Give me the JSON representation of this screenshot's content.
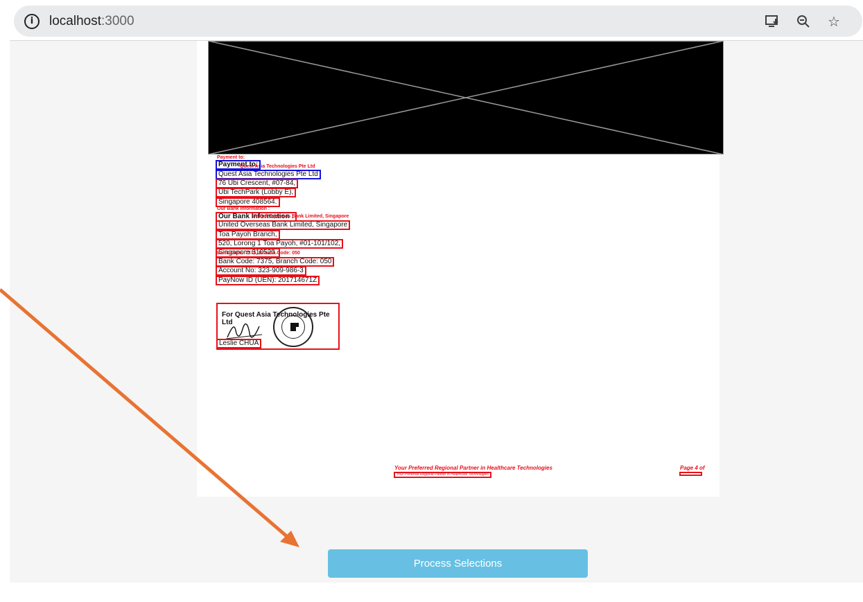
{
  "browser": {
    "url_host": "localhost",
    "url_port": ":3000",
    "icons": [
      "info-icon",
      "install-app-icon",
      "zoom-out-icon",
      "bookmark-star-icon"
    ]
  },
  "document": {
    "payment_to_small": "Payment to:",
    "payment_to_heading": "Payment to:",
    "company_small": "Quest Asia Technologies Pte Ltd",
    "company_name": "Quest Asia Technologies Pte Ltd",
    "address_1": "76 Ubi Crescent, #07-84,",
    "address_2": "Ubi TechPark (Lobby E),",
    "address_3": "Singapore 408564.",
    "bank_info_small": "Our Bank Information :",
    "bank_info_heading": "Our Bank Information :",
    "bank_small": "United Overseas Bank Limited, Singapore",
    "bank_name": "United Overseas Bank Limited, Singapore",
    "branch_1": "Toa Payoh Branch,",
    "branch_address": "520, Lorong 1 Toa Payoh, #01-101/102,",
    "branch_city": "Singapore 310520.",
    "bank_code_small": "Bank Code: 7375, Branch Code: 050",
    "bank_code": "Bank Code: 7375, Branch Code: 050",
    "account_no": "Account No: 323-909-986-3",
    "paynow": "PayNow ID (UEN): 201714671Z",
    "signature_company": "For Quest Asia Technologies Pte Ltd",
    "signatory": "Leslie CHUA",
    "footer_tagline": "Your Preferred Regional Partner in Healthcare Technologies",
    "footer_tagline_small": "Your Preferred Regional Partner in Healthcare Technologies",
    "page_label": "Page 4 of"
  },
  "actions": {
    "process_label": "Process Selections"
  },
  "colors": {
    "button": "#67c0e3",
    "red_box": "#e8101a",
    "blue_box": "#1511d8",
    "arrow": "#e87333"
  }
}
